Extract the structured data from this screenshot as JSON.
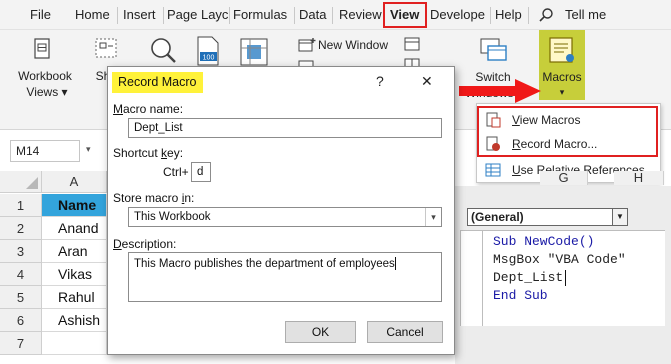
{
  "menu": {
    "tabs": [
      "File",
      "Home",
      "Insert",
      "Page Layc",
      "Formulas",
      "Data",
      "Review",
      "View",
      "Develope",
      "Help"
    ],
    "tell_me": "Tell me"
  },
  "ribbon": {
    "workbook_views": "Workbook",
    "workbook_views2": "Views",
    "show_partial": "Sh",
    "new_window": "New Window",
    "switch": "Switch",
    "windows": "Windows",
    "macros": "Macros"
  },
  "macros_menu": {
    "items": [
      {
        "label": "View Macros",
        "underline": "V",
        "rest": "iew Macros",
        "icon": "view-macros-icon"
      },
      {
        "label": "Record Macro...",
        "underline": "R",
        "rest": "ecord Macro...",
        "icon": "record-macro-icon"
      },
      {
        "label": "Use Relative References",
        "underline": "U",
        "rest": "se Relative References",
        "icon": "relative-references-icon"
      }
    ]
  },
  "sheet": {
    "name_box": "M14",
    "columns": [
      "A",
      "G",
      "H"
    ],
    "rows": [
      "1",
      "2",
      "3",
      "4",
      "5",
      "6",
      "7"
    ],
    "cells": [
      "Name",
      "Anand",
      "Aran",
      "Vikas",
      "Rahul",
      "Ashish",
      ""
    ],
    "header_fill": "#33a4dc"
  },
  "vba": {
    "combo": "(General)",
    "code": [
      "Sub NewCode()",
      "MsgBox \"VBA Code\"",
      "Dept_List",
      "End Sub"
    ]
  },
  "dialog": {
    "title": "Record Macro",
    "help": "?",
    "close": "✕",
    "macro_name_label_u": "M",
    "macro_name_label": "acro name:",
    "macro_name_value": "Dept_List",
    "shortcut_label": "Shortcut ",
    "shortcut_label_u": "k",
    "shortcut_label_rest": "ey:",
    "ctrl_label": "Ctrl+",
    "shortcut_value": "d",
    "store_label": "Store macro ",
    "store_label_u": "i",
    "store_label_rest": "n:",
    "store_value": "This Workbook",
    "description_label_u": "D",
    "description_label": "escription:",
    "description_value": "This Macro publishes the department of employees",
    "ok": "OK",
    "cancel": "Cancel"
  },
  "colors": {
    "highlight_red": "#e02020",
    "title_highlight": "#fff23a",
    "macros_highlight": "#c7ce3a"
  }
}
